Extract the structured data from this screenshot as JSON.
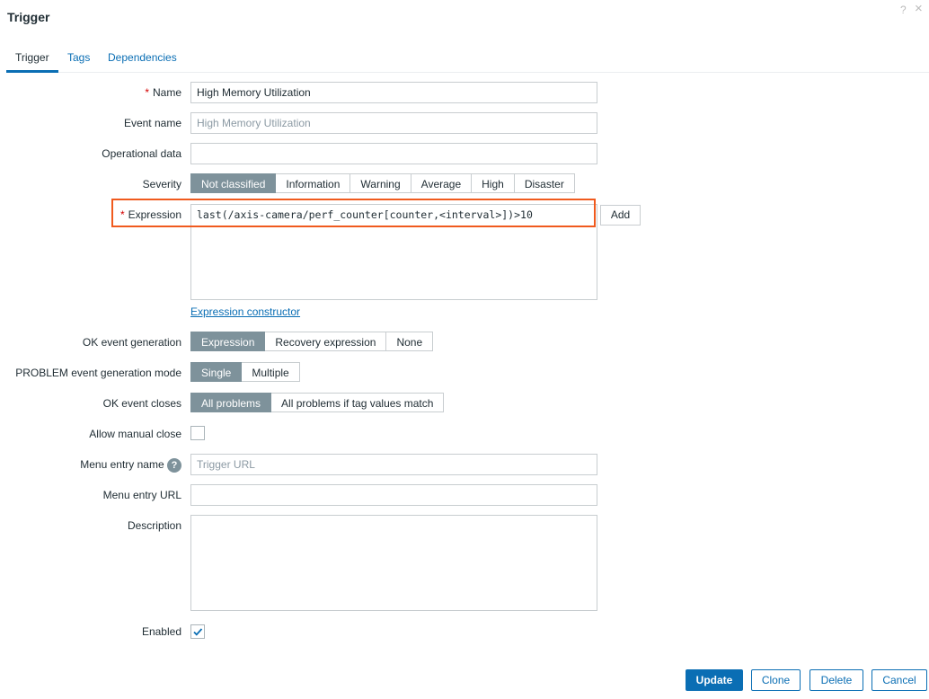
{
  "dialog": {
    "title": "Trigger",
    "help_icon": "?",
    "close_icon": "×"
  },
  "tabs": [
    "Trigger",
    "Tags",
    "Dependencies"
  ],
  "form": {
    "name_label": "Name",
    "name_value": "High Memory Utilization",
    "event_name_label": "Event name",
    "event_name_placeholder": "High Memory Utilization",
    "opdata_label": "Operational data",
    "opdata_value": "",
    "severity_label": "Severity",
    "severity_options": [
      "Not classified",
      "Information",
      "Warning",
      "Average",
      "High",
      "Disaster"
    ],
    "severity_selected": "Not classified",
    "expression_label": "Expression",
    "expression_value": "last(/axis-camera/perf_counter[counter,<interval>])>10",
    "add_label": "Add",
    "constructor_link": "Expression constructor",
    "ok_gen_label": "OK event generation",
    "ok_gen_options": [
      "Expression",
      "Recovery expression",
      "None"
    ],
    "problem_mode_label": "PROBLEM event generation mode",
    "problem_mode_options": [
      "Single",
      "Multiple"
    ],
    "ok_closes_label": "OK event closes",
    "ok_closes_options": [
      "All problems",
      "All problems if tag values match"
    ],
    "manual_close_label": "Allow manual close",
    "manual_close_checked": false,
    "menu_name_label": "Menu entry name",
    "menu_name_placeholder": "Trigger URL",
    "menu_url_label": "Menu entry URL",
    "menu_url_value": "",
    "description_label": "Description",
    "description_value": "",
    "enabled_label": "Enabled",
    "enabled_checked": true
  },
  "buttons": {
    "update": "Update",
    "clone": "Clone",
    "delete": "Delete",
    "cancel": "Cancel"
  },
  "colors": {
    "accent": "#0a6eb4",
    "highlight": "#f05a1e",
    "selected_segment": "#7e929b"
  }
}
